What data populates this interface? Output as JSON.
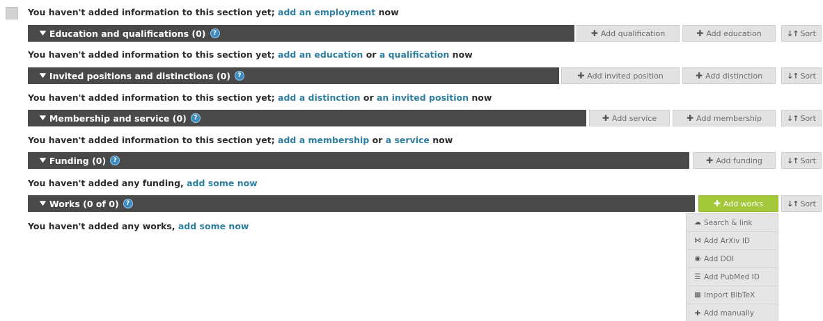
{
  "employment": {
    "msg_prefix": "You haven't added information to this section yet; ",
    "link": "add an employment",
    "msg_suffix": " now"
  },
  "education": {
    "title": "Education and qualifications (0)",
    "help": "?",
    "buttons": {
      "qualification": "Add qualification",
      "education": "Add education",
      "sort": "Sort"
    },
    "msg_prefix": "You haven't added information to this section yet; ",
    "link1": "add an education",
    "mid": " or ",
    "link2": "a qualification",
    "msg_suffix": " now"
  },
  "invited": {
    "title": "Invited positions and distinctions (0)",
    "help": "?",
    "buttons": {
      "invited_position": "Add invited position",
      "distinction": "Add distinction",
      "sort": "Sort"
    },
    "msg_prefix": "You haven't added information to this section yet; ",
    "link1": "add a distinction",
    "mid": " or ",
    "link2": "an invited position",
    "msg_suffix": " now"
  },
  "membership": {
    "title": "Membership and service (0)",
    "help": "?",
    "buttons": {
      "service": "Add service",
      "membership": "Add membership",
      "sort": "Sort"
    },
    "msg_prefix": "You haven't added information to this section yet; ",
    "link1": "add a membership",
    "mid": " or ",
    "link2": "a service",
    "msg_suffix": " now"
  },
  "funding": {
    "title": "Funding (0)",
    "help": "?",
    "buttons": {
      "funding": "Add funding",
      "sort": "Sort"
    },
    "msg_prefix": "You haven't added any funding, ",
    "link": "add some now"
  },
  "works": {
    "title": "Works (0 of 0)",
    "help": "?",
    "buttons": {
      "works": "Add works",
      "sort": "Sort"
    },
    "msg_prefix": "You haven't added any works, ",
    "link": "add some now",
    "dropdown": {
      "search_link": "Search & link",
      "arxiv": "Add ArXiv ID",
      "doi": "Add DOI",
      "pubmed": "Add PubMed ID",
      "bibtex": "Import BibTeX",
      "manual": "Add manually"
    }
  },
  "colors": {
    "bar": "#494949",
    "link": "#2e7f9f",
    "accent_green": "#a3c93a",
    "button_bg": "#e2e2e2"
  },
  "icons": {
    "chevron": "chevron-down-icon",
    "help": "help-icon",
    "plus": "plus-icon",
    "sort": "sort-icon"
  }
}
